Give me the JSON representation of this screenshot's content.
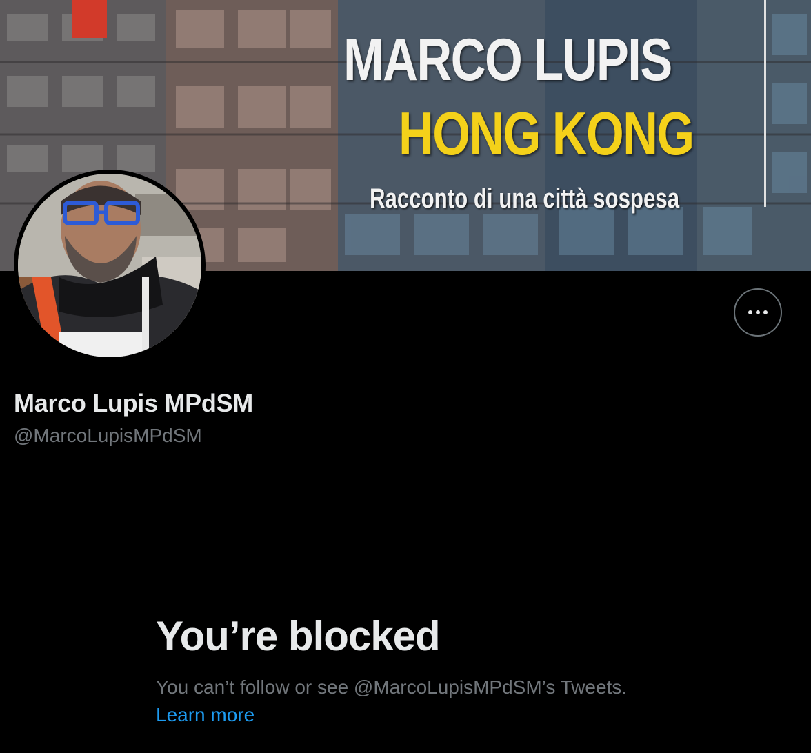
{
  "banner": {
    "title": "MARCO LUPIS",
    "subtitle": "HONG KONG",
    "tagline": "Racconto di una città sospesa",
    "title_color": "#f2f2f2",
    "subtitle_color": "#f4d11a"
  },
  "profile": {
    "display_name": "Marco Lupis MPdSM",
    "handle": "@MarcoLupisMPdSM",
    "avatar_icon": "profile-photo",
    "more_icon": "ellipsis-horizontal-icon"
  },
  "blocked": {
    "heading": "You’re blocked",
    "message": "You can’t follow or see @MarcoLupisMPdSM’s Tweets.",
    "learn_more": "Learn more",
    "link_color": "#1d9bf0"
  },
  "colors": {
    "background": "#000000",
    "primary_text": "#e7e9ea",
    "secondary_text": "#71767b"
  }
}
